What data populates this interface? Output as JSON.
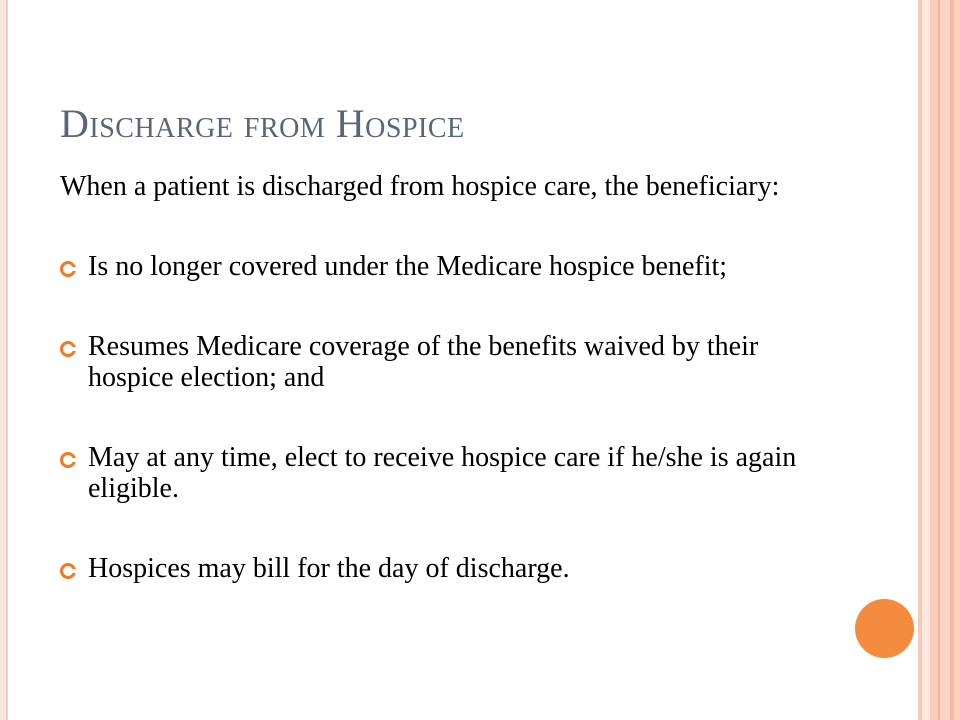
{
  "slide": {
    "title": "Discharge from Hospice",
    "intro": "When a patient is discharged from hospice care, the beneficiary:",
    "bullets": [
      "Is no longer covered under the Medicare hospice benefit;",
      "Resumes Medicare coverage of the benefits waived by their hospice election; and",
      "May at any time, elect to receive hospice care if he/she is again eligible.",
      "Hospices may bill for the day of discharge."
    ]
  },
  "theme": {
    "title_color": "#5a6678",
    "accent": "#f47920",
    "stripe_color": "#fbcdb8",
    "circle_color": "#f58b3e",
    "bullet_icon": "orange-ring-bullet"
  }
}
